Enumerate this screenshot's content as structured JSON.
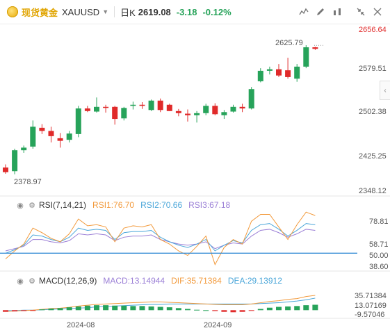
{
  "header": {
    "instrument_name": "现货黄金",
    "symbol": "XAUUSD",
    "period": "日K",
    "price": "2619.08",
    "change": "-3.18",
    "change_pct": "-0.12%"
  },
  "colors": {
    "up": "#27a35a",
    "down": "#e02a2a",
    "rsi1": "#f29a3c",
    "rsi2": "#4aa6d9",
    "rsi3": "#9b7fd6",
    "macd_dif": "#f29a3c",
    "macd_dea": "#4aa6d9",
    "ref_line": "#3a8fd6",
    "brand": "#e0a400"
  },
  "price_axis": {
    "ticks": [
      "2656.64",
      "2579.51",
      "2502.38",
      "2425.25",
      "2348.12"
    ]
  },
  "annotations": {
    "high": "2625.79",
    "low": "2378.97"
  },
  "rsi": {
    "title": "RSI(7,14,21)",
    "rsi1": "RSI1:76.70",
    "rsi2": "RSI2:70.66",
    "rsi3": "RSI3:67.18",
    "ticks": [
      "78.81",
      "58.71",
      "50.00",
      "38.60"
    ]
  },
  "macd": {
    "title": "MACD(12,26,9)",
    "macd": "MACD:13.14944",
    "dif": "DIF:35.71384",
    "dea": "DEA:29.13912",
    "ticks": [
      "35.71384",
      "13.07169",
      "-9.57046"
    ]
  },
  "time_axis": [
    "2024-08",
    "2024-09"
  ],
  "chart_data": {
    "type": "candlestick",
    "candles": [
      {
        "o": 2392,
        "h": 2398,
        "l": 2380,
        "c": 2383
      },
      {
        "o": 2385,
        "h": 2428,
        "l": 2379,
        "c": 2425
      },
      {
        "o": 2425,
        "h": 2434,
        "l": 2420,
        "c": 2430
      },
      {
        "o": 2432,
        "h": 2482,
        "l": 2428,
        "c": 2470
      },
      {
        "o": 2468,
        "h": 2475,
        "l": 2456,
        "c": 2462
      },
      {
        "o": 2462,
        "h": 2470,
        "l": 2440,
        "c": 2452
      },
      {
        "o": 2448,
        "h": 2458,
        "l": 2430,
        "c": 2443
      },
      {
        "o": 2445,
        "h": 2462,
        "l": 2440,
        "c": 2457
      },
      {
        "o": 2456,
        "h": 2510,
        "l": 2450,
        "c": 2505
      },
      {
        "o": 2505,
        "h": 2510,
        "l": 2498,
        "c": 2500
      },
      {
        "o": 2499,
        "h": 2526,
        "l": 2497,
        "c": 2508
      },
      {
        "o": 2508,
        "h": 2512,
        "l": 2497,
        "c": 2506
      },
      {
        "o": 2508,
        "h": 2510,
        "l": 2474,
        "c": 2485
      },
      {
        "o": 2486,
        "h": 2508,
        "l": 2482,
        "c": 2506
      },
      {
        "o": 2510,
        "h": 2518,
        "l": 2503,
        "c": 2512
      },
      {
        "o": 2512,
        "h": 2517,
        "l": 2504,
        "c": 2510
      },
      {
        "o": 2502,
        "h": 2522,
        "l": 2500,
        "c": 2520
      },
      {
        "o": 2520,
        "h": 2524,
        "l": 2498,
        "c": 2502
      },
      {
        "o": 2512,
        "h": 2514,
        "l": 2500,
        "c": 2500
      },
      {
        "o": 2500,
        "h": 2504,
        "l": 2490,
        "c": 2496
      },
      {
        "o": 2495,
        "h": 2503,
        "l": 2480,
        "c": 2492
      },
      {
        "o": 2492,
        "h": 2500,
        "l": 2478,
        "c": 2496
      },
      {
        "o": 2496,
        "h": 2514,
        "l": 2492,
        "c": 2510
      },
      {
        "o": 2510,
        "h": 2515,
        "l": 2492,
        "c": 2494
      },
      {
        "o": 2492,
        "h": 2502,
        "l": 2485,
        "c": 2498
      },
      {
        "o": 2499,
        "h": 2512,
        "l": 2497,
        "c": 2508
      },
      {
        "o": 2508,
        "h": 2514,
        "l": 2498,
        "c": 2505
      },
      {
        "o": 2505,
        "h": 2546,
        "l": 2503,
        "c": 2542
      },
      {
        "o": 2557,
        "h": 2582,
        "l": 2555,
        "c": 2577
      },
      {
        "o": 2577,
        "h": 2585,
        "l": 2570,
        "c": 2580
      },
      {
        "o": 2580,
        "h": 2590,
        "l": 2565,
        "c": 2568
      },
      {
        "o": 2578,
        "h": 2602,
        "l": 2562,
        "c": 2565
      },
      {
        "o": 2562,
        "h": 2590,
        "l": 2556,
        "c": 2585
      },
      {
        "o": 2585,
        "h": 2626,
        "l": 2582,
        "c": 2622
      },
      {
        "o": 2622,
        "h": 2623,
        "l": 2617,
        "c": 2619
      }
    ],
    "rsi_series": [
      {
        "name": "RSI1",
        "values": [
          45,
          52,
          58,
          72,
          68,
          63,
          60,
          67,
          80,
          74,
          75,
          73,
          60,
          72,
          74,
          73,
          75,
          62,
          58,
          52,
          48,
          56,
          65,
          40,
          55,
          62,
          58,
          78,
          84,
          84,
          73,
          62,
          75,
          86,
          83
        ]
      },
      {
        "name": "RSI2",
        "values": [
          50,
          53,
          57,
          66,
          65,
          62,
          60,
          64,
          72,
          70,
          71,
          70,
          62,
          68,
          69,
          69,
          70,
          64,
          60,
          57,
          55,
          58,
          62,
          52,
          57,
          61,
          59,
          70,
          75,
          76,
          71,
          65,
          70,
          76,
          75
        ]
      },
      {
        "name": "RSI3",
        "values": [
          52,
          54,
          56,
          62,
          62,
          60,
          59,
          61,
          67,
          66,
          67,
          66,
          61,
          64,
          65,
          65,
          66,
          62,
          60,
          58,
          57,
          58,
          60,
          54,
          57,
          59,
          58,
          65,
          70,
          71,
          68,
          64,
          67,
          71,
          70
        ]
      }
    ],
    "macd_series": {
      "dif": [
        -3,
        -2,
        -1,
        0,
        2,
        4,
        5,
        7,
        10,
        12,
        14,
        15,
        16,
        17,
        18,
        19,
        20,
        20,
        19,
        18,
        17,
        16,
        15,
        14,
        13,
        13,
        13,
        15,
        18,
        21,
        23,
        26,
        28,
        33,
        35.7
      ],
      "dea": [
        -1,
        -1,
        0,
        0,
        1,
        2,
        3,
        4,
        5,
        6,
        8,
        9,
        10,
        11,
        12,
        13,
        14,
        14,
        15,
        15,
        15,
        15,
        15,
        15,
        15,
        15,
        15,
        15,
        16,
        17,
        18,
        20,
        22,
        25,
        29.1
      ],
      "macd": [
        -4,
        -3,
        -2,
        -1,
        2,
        4,
        5,
        7,
        9,
        11,
        12,
        12,
        11,
        11,
        10,
        10,
        9,
        8,
        7,
        5,
        3,
        1,
        0,
        -2,
        -4,
        -5,
        -4,
        -1,
        3,
        6,
        8,
        9,
        10,
        12,
        13.1
      ]
    }
  }
}
